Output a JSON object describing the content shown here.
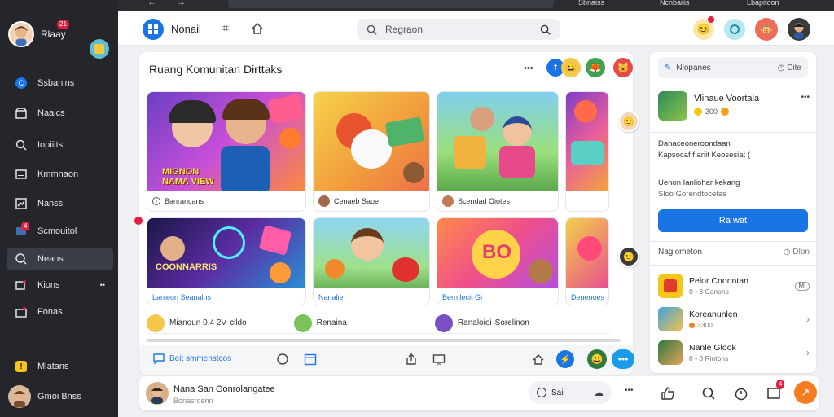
{
  "sidebar": {
    "user_name": "Rlaay",
    "user_badge": "21",
    "items": [
      {
        "label": "Ssbanins",
        "icon": "circle-c-icon"
      },
      {
        "label": "Naaics",
        "icon": "store-icon"
      },
      {
        "label": "Iopiiits",
        "icon": "search-icon"
      },
      {
        "label": "Kmmnaon",
        "icon": "list-icon"
      },
      {
        "label": "Nanss",
        "icon": "chart-icon"
      },
      {
        "label": "Scmouitol",
        "icon": "chat-icon",
        "badge": "4"
      },
      {
        "label": "Neans",
        "icon": "message-icon"
      },
      {
        "label": "Kions",
        "icon": "group-icon",
        "more": "••"
      },
      {
        "label": "Fonas",
        "icon": "store-icon"
      }
    ],
    "footer_item": "Mlatans",
    "footer_user": "Gmoi Bnss"
  },
  "topbar": {
    "app_name": "Nonail",
    "search_placeholder": "Regraon",
    "browser_tabs": [
      "Sbnaiss",
      "Ncnbaiiis",
      "Lbapitoon"
    ]
  },
  "main": {
    "title": "Ruang Komunitan Dirttaks",
    "more": "•••",
    "row1": [
      {
        "art_text": "MIGNON NAMA VIEW",
        "caption": "Banrancans"
      },
      {
        "caption": "Cenaeb Saoe"
      },
      {
        "caption": "Scendad Oiotes"
      },
      {
        "caption": ""
      }
    ],
    "row2": [
      {
        "art_text": "COONNARRIS",
        "caption": "Lanieon Seanalns"
      },
      {
        "caption": "Nanalie"
      },
      {
        "art_text": "BO",
        "caption": "Bern lecit Gi"
      },
      {
        "caption": "Denenoes"
      }
    ],
    "people": [
      {
        "name": "Mianoun 0.4 2V",
        "extra": "cildo"
      },
      {
        "name": "Renaina"
      },
      {
        "name": "Ranaloioi",
        "extra": "Sorelinon"
      }
    ],
    "action_bar_label": "Beit smmenstcos"
  },
  "right": {
    "header_label": "Nlopanes",
    "header_right": "Cite",
    "profile_name": "Vlinaue Voortala",
    "profile_stats": "300",
    "desc_line1": "Danaceoneroondaan",
    "desc_line2": "Kapsocaf f ariit Keosesiat (",
    "desc_line3": "Uenon Ianliohar kekang",
    "desc_line4": "Sloo Gorendtocetas",
    "cta_label": "Ra wat",
    "section_title": "Nagiometon",
    "section_right": "Dlon",
    "list": [
      {
        "name": "Pelor Cnonntan",
        "meta": "0 • 3 Canons",
        "tag": "Mi"
      },
      {
        "name": "Koreanunlen",
        "meta": "3300"
      },
      {
        "name": "Nanle Glook",
        "meta": "0 • 3 Rintons"
      }
    ]
  },
  "bottom": {
    "name": "Nana San Oonrolangatee",
    "sub": "Bonasrdenn",
    "search_label": "Saii",
    "badge": "4"
  },
  "colors": {
    "accent": "#1877f2",
    "sidebar_bg": "#24262b",
    "cta": "#1b74e4",
    "orange": "#f57c1f"
  }
}
